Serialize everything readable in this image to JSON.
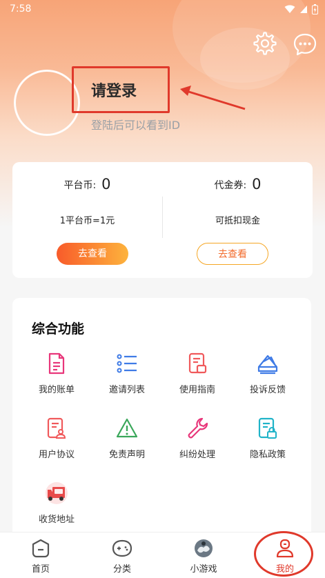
{
  "status": {
    "time": "7:58"
  },
  "profile": {
    "title": "请登录",
    "subtitle": "登陆后可以看到ID"
  },
  "icons": {
    "settings": "gear-icon",
    "message": "chat-bubble-icon"
  },
  "coins": {
    "platform": {
      "label": "平台币:",
      "value": "0",
      "note": "1平台币=1元",
      "button": "去查看"
    },
    "voucher": {
      "label": "代金券:",
      "value": "0",
      "note": "可抵扣现金",
      "button": "去查看"
    }
  },
  "features": {
    "title": "综合功能",
    "items": [
      {
        "label": "我的账单",
        "icon": "bill-icon"
      },
      {
        "label": "邀请列表",
        "icon": "list-icon"
      },
      {
        "label": "使用指南",
        "icon": "guide-icon"
      },
      {
        "label": "投诉反馈",
        "icon": "feedback-envelope-icon"
      },
      {
        "label": "用户协议",
        "icon": "agreement-icon"
      },
      {
        "label": "免责声明",
        "icon": "warning-icon"
      },
      {
        "label": "纠纷处理",
        "icon": "wrench-icon"
      },
      {
        "label": "隐私政策",
        "icon": "privacy-lock-icon"
      },
      {
        "label": "收货地址",
        "icon": "delivery-truck-icon"
      }
    ]
  },
  "tabs": [
    {
      "label": "首页",
      "icon": "home-icon"
    },
    {
      "label": "分类",
      "icon": "gamepad-icon"
    },
    {
      "label": "小游戏",
      "icon": "mini-game-icon"
    },
    {
      "label": "我的",
      "icon": "user-icon",
      "active": true
    }
  ],
  "colors": {
    "accent": "#e0392b",
    "orange": "#f26b2c",
    "pink": "#e8367a",
    "blue": "#3f7be6",
    "green": "#3aa75a",
    "teal": "#1fb3c8"
  }
}
